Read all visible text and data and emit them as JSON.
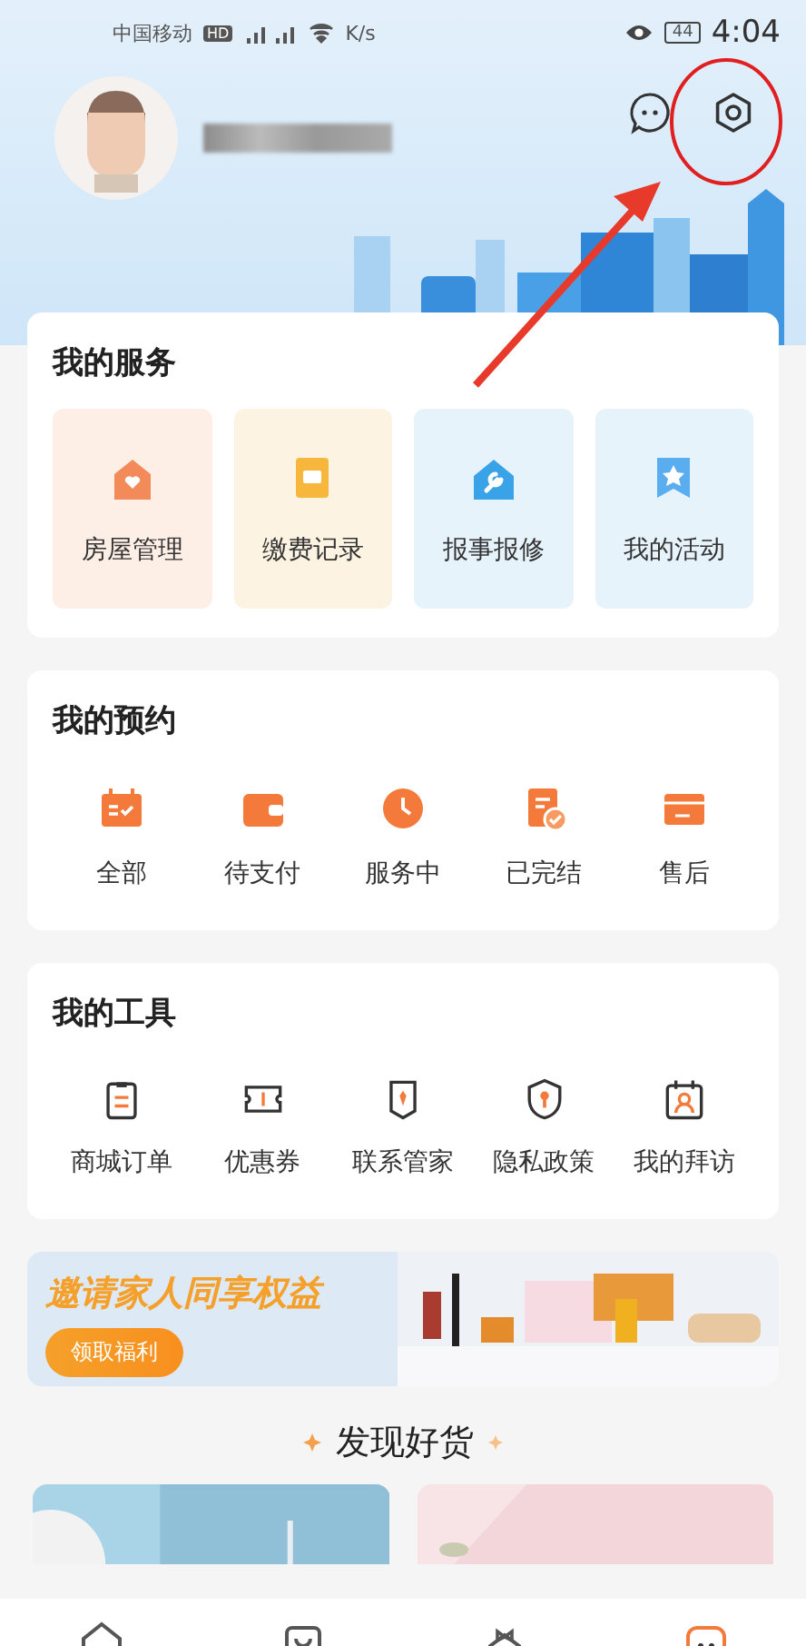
{
  "status_bar": {
    "carrier": "中国移动",
    "hd": "HD",
    "speed_unit": "K/s",
    "battery": "44",
    "time": "4:04"
  },
  "services": {
    "title": "我的服务",
    "items": [
      {
        "label": "房屋管理",
        "kind": "house",
        "color": "#fdeee6"
      },
      {
        "label": "缴费记录",
        "kind": "bill",
        "color": "#fdf3e3"
      },
      {
        "label": "报事报修",
        "kind": "repair",
        "color": "#e6f3fb"
      },
      {
        "label": "我的活动",
        "kind": "activity",
        "color": "#e6f3fb"
      }
    ]
  },
  "bookings": {
    "title": "我的预约",
    "items": [
      {
        "label": "全部",
        "kind": "calendar"
      },
      {
        "label": "待支付",
        "kind": "wallet"
      },
      {
        "label": "服务中",
        "kind": "clock"
      },
      {
        "label": "已完结",
        "kind": "done"
      },
      {
        "label": "售后",
        "kind": "card"
      }
    ]
  },
  "tools": {
    "title": "我的工具",
    "items": [
      {
        "label": "商城订单",
        "kind": "clipboard"
      },
      {
        "label": "优惠券",
        "kind": "ticket"
      },
      {
        "label": "联系管家",
        "kind": "tie"
      },
      {
        "label": "隐私政策",
        "kind": "shield"
      },
      {
        "label": "我的拜访",
        "kind": "visit"
      }
    ]
  },
  "banner": {
    "headline": "邀请家人同享权益",
    "button": "领取福利"
  },
  "discover": {
    "title": "发现好货"
  },
  "bottom_nav": [
    {
      "kind": "home",
      "selected": false
    },
    {
      "kind": "bag",
      "selected": false
    },
    {
      "kind": "butler",
      "selected": false
    },
    {
      "kind": "me",
      "selected": true
    }
  ]
}
